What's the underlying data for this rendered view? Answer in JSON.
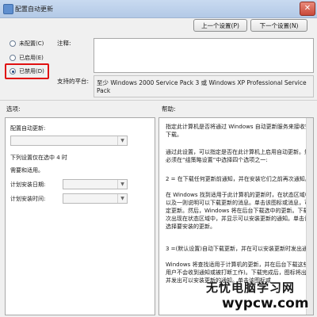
{
  "window": {
    "title": "配置自动更新",
    "close_glyph": "✕"
  },
  "nav": {
    "prev_label": "上一个设置(P)",
    "next_label": "下一个设置(N)"
  },
  "policy_state": {
    "options": [
      {
        "label": "未配置(C)",
        "checked": false
      },
      {
        "label": "已启用(E)",
        "checked": false
      },
      {
        "label": "已禁用(D)",
        "checked": true
      }
    ]
  },
  "fields": {
    "comment_label": "注释:",
    "platform_label": "支持的平台:",
    "platform_value": "至少 Windows 2000 Service Pack 3 或 Windows XP Professional Service Pack"
  },
  "sections": {
    "options_label": "选项:",
    "help_label": "帮助:"
  },
  "options_panel": {
    "configure_label": "配置自动更新:",
    "note_line1": "下列设置仅在选中 4 时",
    "note_line2": "需要和适用。",
    "schedule_day_label": "计划安装日期:",
    "schedule_time_label": "计划安装时间:"
  },
  "help": {
    "paragraphs": [
      "指定此计算机是否将通过 Windows 自动更新服务来接收安全更新和其他重要下载。",
      "通过此设置，可以指定是否在此计算机上启用自动更新。如果启用该服务，则必须在“组策略设置”中选择四个选项之一:",
      "2 = 在下载任何更新前通知，并在安装它们之前再次通知。",
      "在 Windows 找到适用于此计算机的更新时，在状态区域中将出现一个图标，以及一则说明可以下载更新的消息。单击该图标或消息，可以选择要下载的特定更新。然后，Windows 将在后台下载选中的更新。下载完成后，图标将再次出现在状态区域中，并显示可以安装更新的通知。单击该图标或消息，可以选择要安装的更新。",
      "3 =(默认设置)自动下载更新，并在可以安装更新时发出通知。",
      "Windows 将查找适用于计算机的更新，并在后台下载这些更新(在此进程中，用户不会收到通知或被打断工作)。下载完成后，图标将出现在状态区域中，并发出可以安装更新的通知。单击该图标或"
    ]
  },
  "watermark": {
    "title": "无忧电脑学习网",
    "url": "wypcw.com"
  }
}
